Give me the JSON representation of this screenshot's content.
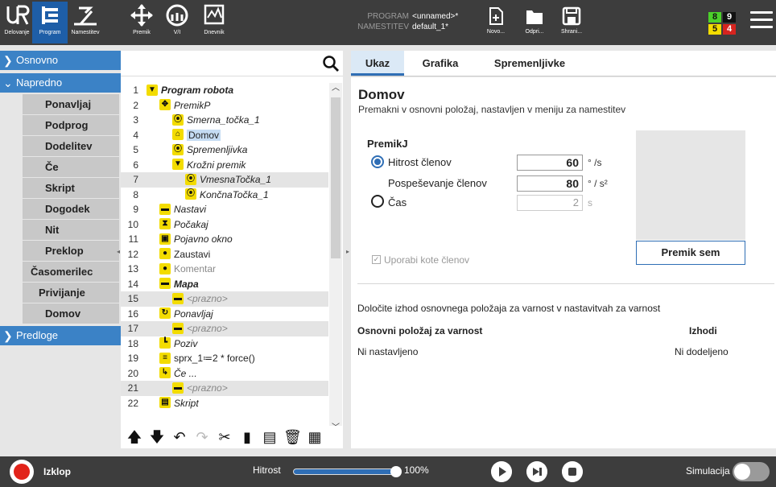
{
  "topbar": {
    "nav": [
      {
        "label": "Delovanje",
        "icon": "ur-logo-icon"
      },
      {
        "label": "Program",
        "icon": "program-icon",
        "active": true
      },
      {
        "label": "Namestitev",
        "icon": "installation-icon"
      },
      {
        "label": "Premik",
        "icon": "move-icon"
      },
      {
        "label": "V/I",
        "icon": "io-icon"
      },
      {
        "label": "Dnevnik",
        "icon": "log-icon"
      }
    ],
    "program_key": "PROGRAM",
    "program_val": "<unnamed>*",
    "install_key": "NAMESTITEV",
    "install_val": "default_1*",
    "files": [
      {
        "label": "Novo...",
        "icon": "new-file-icon"
      },
      {
        "label": "Odpri...",
        "icon": "open-folder-icon"
      },
      {
        "label": "Shrani...",
        "icon": "save-icon"
      }
    ],
    "status": {
      "a": "8",
      "b": "9",
      "c": "5",
      "d": "4"
    },
    "colors": {
      "bar": "#3d3d3d",
      "active": "#1e5ea7",
      "green": "#4bd12a",
      "red": "#d6241f",
      "yellow": "#f3dc00"
    }
  },
  "sidebar": {
    "basic": "Osnovno",
    "advanced": "Napredno",
    "items": [
      "Ponavljaj",
      "Podprog",
      "Dodelitev",
      "Če",
      "Skript",
      "Dogodek",
      "Nit",
      "Preklop",
      "Časomerilec",
      "Privijanje",
      "Domov"
    ],
    "templates": "Predloge"
  },
  "tree": {
    "search_placeholder": "",
    "rows": [
      {
        "n": "1",
        "text": "Program robota",
        "icon": "▼",
        "style": "bi"
      },
      {
        "n": "2",
        "text": "PremikP",
        "icon": "✥",
        "style": "ital"
      },
      {
        "n": "3",
        "text": "Smerna_točka_1",
        "icon": "⦿",
        "style": "ital"
      },
      {
        "n": "4",
        "text": "Domov",
        "icon": "⌂",
        "style": "sel"
      },
      {
        "n": "5",
        "text": "Spremenljivka",
        "icon": "⦿",
        "style": "ital"
      },
      {
        "n": "6",
        "text": "Krožni premik",
        "icon": "▼",
        "style": "ital"
      },
      {
        "n": "7",
        "text": "VmesnaTočka_1",
        "icon": "⦿",
        "style": "ital"
      },
      {
        "n": "8",
        "text": "KončnaTočka_1",
        "icon": "⦿",
        "style": "ital"
      },
      {
        "n": "9",
        "text": "Nastavi",
        "icon": "▬",
        "style": "ital"
      },
      {
        "n": "10",
        "text": "Počakaj",
        "icon": "⧗",
        "style": "ital"
      },
      {
        "n": "11",
        "text": "Pojavno okno",
        "icon": "▣",
        "style": "ital"
      },
      {
        "n": "12",
        "text": "Zaustavi",
        "icon": "●",
        "style": ""
      },
      {
        "n": "13",
        "text": "Komentar",
        "icon": "●",
        "style": "gray-n"
      },
      {
        "n": "14",
        "text": "Mapa",
        "icon": "▬",
        "style": "bi"
      },
      {
        "n": "15",
        "text": "<prazno>",
        "icon": "▬",
        "style": "gray"
      },
      {
        "n": "16",
        "text": "Ponavljaj",
        "icon": "↻",
        "style": "ital"
      },
      {
        "n": "17",
        "text": "<prazno>",
        "icon": "▬",
        "style": "gray"
      },
      {
        "n": "18",
        "text": "Poziv",
        "icon": "┗",
        "style": "ital"
      },
      {
        "n": "19",
        "text": "sprx_1≔2 * force()",
        "icon": "≡",
        "style": ""
      },
      {
        "n": "20",
        "text": "Če ...",
        "icon": "↳",
        "style": "ital"
      },
      {
        "n": "21",
        "text": "<prazno>",
        "icon": "▬",
        "style": "gray"
      },
      {
        "n": "22",
        "text": "Skript",
        "icon": "▤",
        "style": "ital"
      }
    ],
    "toolbar": [
      "arrow-up-icon",
      "arrow-down-icon",
      "undo-icon",
      "redo-icon",
      "cut-icon",
      "copy-icon",
      "paste-icon",
      "delete-icon",
      "suppress-icon"
    ]
  },
  "tabs": [
    "Ukaz",
    "Grafika",
    "Spremenljivke"
  ],
  "panel": {
    "title": "Domov",
    "subtitle": "Premakni v osnovni položaj, nastavljen v meniju za namestitev",
    "move_label": "PremikJ",
    "joint_speed_label": "Hitrost členov",
    "joint_speed": "60",
    "joint_speed_unit": "° /s",
    "joint_accel_label": "Pospeševanje členov",
    "joint_accel": "80",
    "joint_accel_unit": "° / s²",
    "time_label": "Čas",
    "time": "2",
    "time_unit": "s",
    "move_here": "Premik sem",
    "use_joint_angles": "Uporabi kote členov",
    "safety_note": "Določite izhod osnovnega položaja za varnost v nastavitvah za varnost",
    "safety_home_header": "Osnovni položaj za varnost",
    "outputs_header": "Izhodi",
    "safety_home_value": "Ni nastavljeno",
    "outputs_value": "Ni dodeljeno"
  },
  "bottombar": {
    "power_label": "Izklop",
    "speed_label": "Hitrost",
    "speed_value": "100%",
    "speed_fraction": 1.0,
    "sim_label": "Simulacija"
  }
}
